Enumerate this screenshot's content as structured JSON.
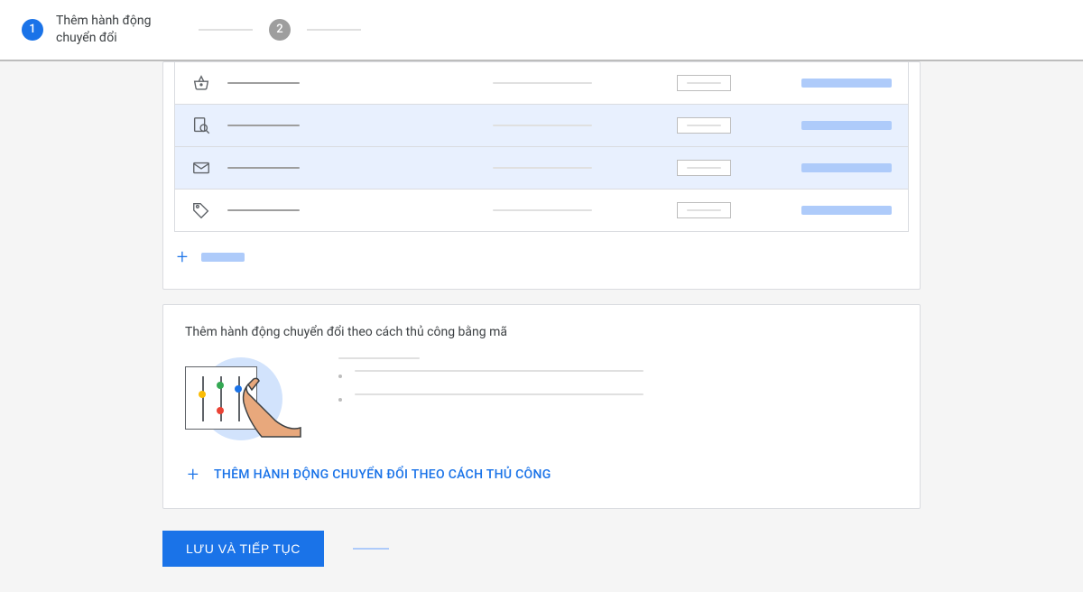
{
  "stepper": {
    "step1": {
      "number": "1",
      "label": "Thêm hành động chuyển đổi"
    },
    "step2": {
      "number": "2"
    }
  },
  "option_rows": [
    {
      "icon": "basket",
      "selected": false
    },
    {
      "icon": "search-doc",
      "selected": true
    },
    {
      "icon": "envelope",
      "selected": true
    },
    {
      "icon": "tag",
      "selected": false
    }
  ],
  "manual_card": {
    "title": "Thêm hành động chuyển đổi theo cách thủ công bằng mã",
    "add_button_label": "THÊM HÀNH ĐỘNG CHUYỂN ĐỔI THEO CÁCH THỦ CÔNG"
  },
  "footer": {
    "primary_label": "LƯU VÀ TIẾP TỤC"
  }
}
